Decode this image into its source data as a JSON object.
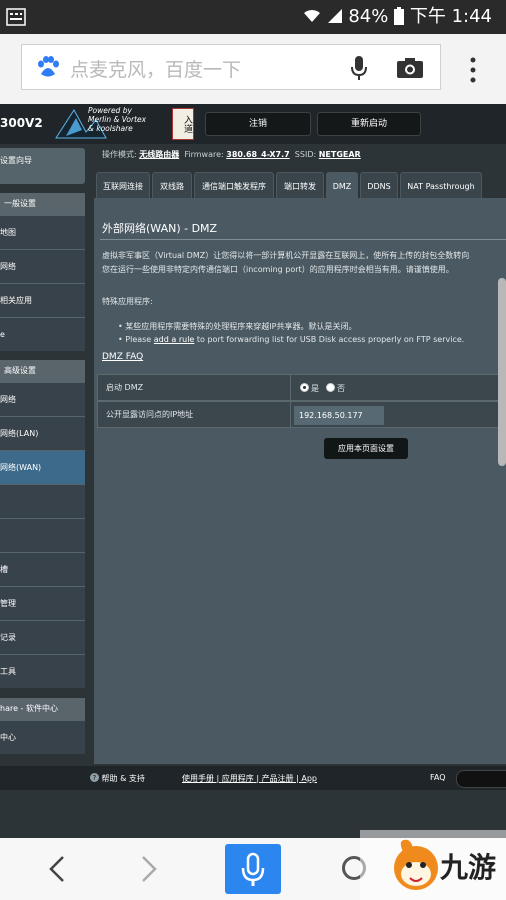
{
  "status_bar": {
    "battery": "84%",
    "time": "下午 1:44"
  },
  "browser": {
    "search_placeholder": "点麦克风，百度一下"
  },
  "router": {
    "model": "300V2",
    "logo_lines": [
      "Powered by",
      "Merlin & Vortex",
      "& koolshare"
    ],
    "logo_badge": "入道",
    "logout_label": "注销",
    "reboot_label": "重新启动",
    "mode_label": "操作模式:",
    "mode_value": "无线路由器",
    "firmware_label": "Firmware:",
    "firmware_value": "380.68_4-X7.7",
    "ssid_label": "SSID:",
    "ssid_value": "NETGEAR",
    "tabs": [
      "互联网连接",
      "双线路",
      "通信端口触发程序",
      "端口转发",
      "DMZ",
      "DDNS",
      "NAT Passthrough"
    ],
    "active_tab": "DMZ",
    "sidebar": {
      "top": "设置向导",
      "general_header": "一般设置",
      "general_items": [
        "地图",
        "网络",
        "相关应用",
        "e"
      ],
      "advanced_header": "高级设置",
      "advanced_items": [
        "网络",
        "网络(LAN)",
        "网络(WAN)",
        "",
        "",
        "槽",
        "管理",
        "记录",
        "工具"
      ],
      "software_header": "hare - 软件中心",
      "software_items": [
        "中心"
      ]
    },
    "page_title": "外部网络(WAN) - DMZ",
    "desc_line1": "虚拟非军事区（Virtual DMZ）让您得以将一部计算机公开显露在互联网上，使所有上传的封包全数转向",
    "desc_line2": "您在运行一些使用非特定内传通信端口（incoming port）的应用程序时会相当有用。请谨慎使用。",
    "special_label": "特殊应用程序:",
    "bullet1": "某些应用程序需要特殊的处理程序来穿越IP共享器。默认是关闭。",
    "bullet2_prefix": "Please",
    "bullet2_link": "add a rule",
    "bullet2_suffix": "to port forwarding list for USB Disk access properly on FTP service.",
    "dmz_faq": "DMZ FAQ",
    "enable_label": "启动 DMZ",
    "radio_yes": "是",
    "radio_no": "否",
    "ip_label": "公开显露访问点的IP地址",
    "ip_value": "192.168.50.177",
    "apply_label": "应用本页面设置",
    "footer": {
      "help": "帮助 & 支持",
      "manual": "使用手册",
      "app": "应用程序",
      "register": "产品注册",
      "app2": "App",
      "faq": "FAQ"
    }
  },
  "watermark": {
    "text": "九游"
  }
}
